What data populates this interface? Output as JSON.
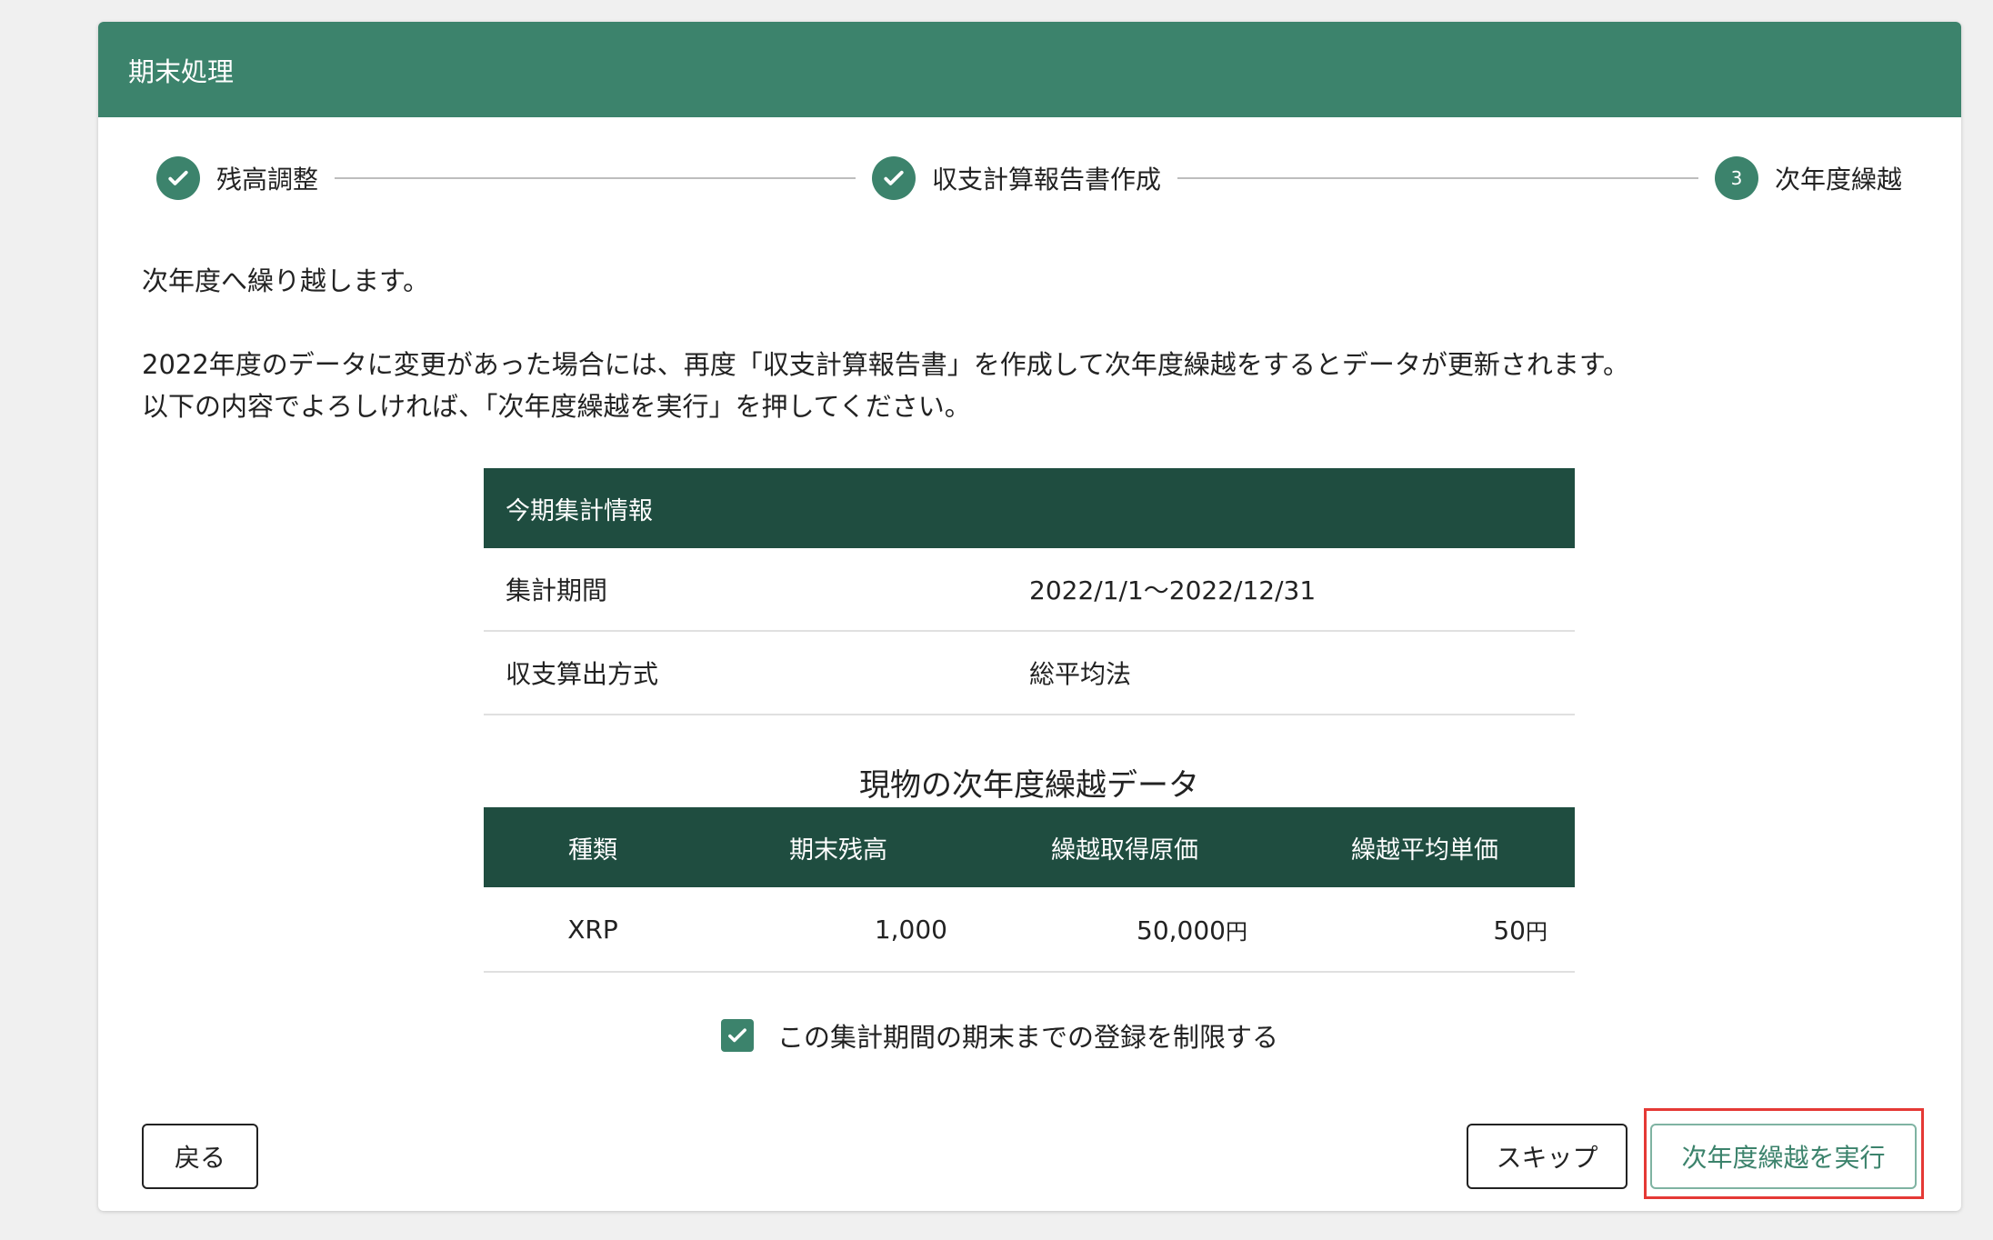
{
  "header": {
    "title": "期末処理"
  },
  "stepper": {
    "steps": [
      {
        "label": "残高調整",
        "state": "done"
      },
      {
        "label": "収支計算報告書作成",
        "state": "done"
      },
      {
        "label": "次年度繰越",
        "state": "active",
        "number": "3"
      }
    ]
  },
  "intro": {
    "line1": "次年度へ繰り越します。",
    "line2": "2022年度のデータに変更があった場合には、再度「収支計算報告書」を作成して次年度繰越をするとデータが更新されます。",
    "line3": "以下の内容でよろしければ、「次年度繰越を実行」を押してください。"
  },
  "info_table": {
    "heading": "今期集計情報",
    "rows": [
      {
        "label": "集計期間",
        "value": "2022/1/1〜2022/12/31"
      },
      {
        "label": "収支算出方式",
        "value": "総平均法"
      }
    ]
  },
  "carry_table": {
    "title": "現物の次年度繰越データ",
    "headers": [
      "種類",
      "期末残高",
      "繰越取得原価",
      "繰越平均単価"
    ],
    "rows": [
      {
        "type": "XRP",
        "balance": "1,000",
        "cost": "50,000",
        "cost_unit": "円",
        "avg": "50",
        "avg_unit": "円"
      }
    ]
  },
  "checkbox": {
    "label": "この集計期間の期末までの登録を制限する",
    "checked": true
  },
  "buttons": {
    "back": "戻る",
    "skip": "スキップ",
    "execute": "次年度繰越を実行"
  },
  "colors": {
    "header_bg": "#3c836c",
    "table_head_bg": "#1f4d40",
    "highlight": "#e53935"
  }
}
